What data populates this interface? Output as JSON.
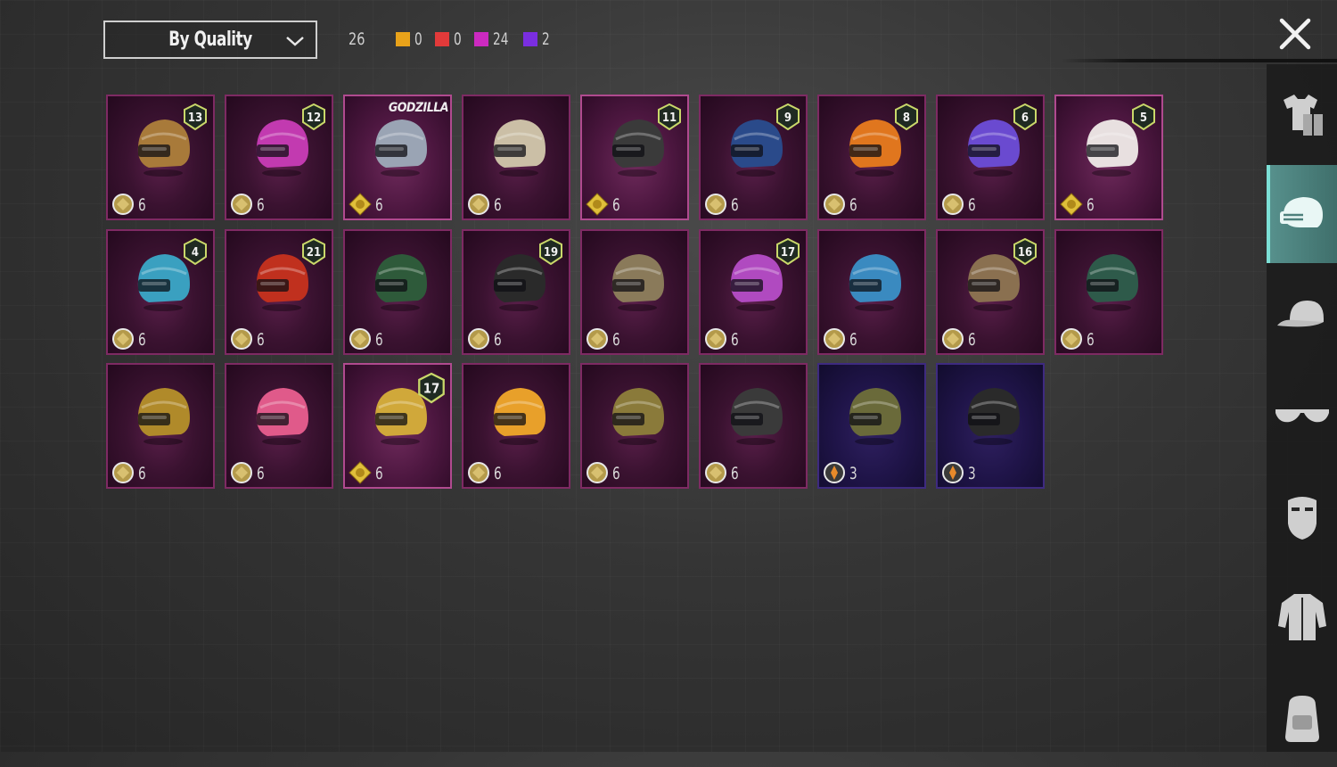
{
  "header": {
    "sort_label": "By Quality",
    "total": "26",
    "quality_counts": [
      {
        "color": "#e8a21a",
        "count": "0"
      },
      {
        "color": "#e23a3a",
        "count": "0"
      },
      {
        "color": "#cc2ac0",
        "count": "24"
      },
      {
        "color": "#7a2ee0",
        "count": "2"
      }
    ]
  },
  "sidebar": {
    "items": [
      {
        "icon": "outfit-icon",
        "active": false
      },
      {
        "icon": "helmet-icon",
        "active": true
      },
      {
        "icon": "cap-icon",
        "active": false
      },
      {
        "icon": "glasses-icon",
        "active": false
      },
      {
        "icon": "mask-icon",
        "active": false
      },
      {
        "icon": "jacket-icon",
        "active": false
      },
      {
        "icon": "backpack-icon",
        "active": false
      }
    ]
  },
  "items": [
    {
      "level": "13",
      "value": "6",
      "coin": "round",
      "color": "#a87a3a",
      "style": "normal"
    },
    {
      "level": "12",
      "value": "6",
      "coin": "round",
      "color": "#c23ab0",
      "style": "normal"
    },
    {
      "level": "",
      "value": "6",
      "coin": "diamond",
      "color": "#9aa4b4",
      "style": "highlight",
      "brand": "GODZILLA"
    },
    {
      "level": "",
      "value": "6",
      "coin": "round",
      "color": "#cbbfa6",
      "style": "normal"
    },
    {
      "level": "11",
      "value": "6",
      "coin": "diamond",
      "color": "#3a3a3a",
      "style": "highlight"
    },
    {
      "level": "9",
      "value": "6",
      "coin": "round",
      "color": "#2a4a8a",
      "style": "normal"
    },
    {
      "level": "8",
      "value": "6",
      "coin": "round",
      "color": "#e0761e",
      "style": "normal"
    },
    {
      "level": "6",
      "value": "6",
      "coin": "round",
      "color": "#6a4ad0",
      "style": "normal"
    },
    {
      "level": "5",
      "value": "6",
      "coin": "diamond",
      "color": "#e8e0e0",
      "style": "highlight"
    },
    {
      "level": "4",
      "value": "6",
      "coin": "round",
      "color": "#3aa0c0",
      "style": "normal"
    },
    {
      "level": "21",
      "value": "6",
      "coin": "round",
      "color": "#c0301e",
      "style": "normal"
    },
    {
      "level": "",
      "value": "6",
      "coin": "round",
      "color": "#2e5a3a",
      "style": "normal"
    },
    {
      "level": "19",
      "value": "6",
      "coin": "round",
      "color": "#2a2a2a",
      "style": "normal"
    },
    {
      "level": "",
      "value": "6",
      "coin": "round",
      "color": "#8a7a5a",
      "style": "normal"
    },
    {
      "level": "17",
      "value": "6",
      "coin": "round",
      "color": "#b04ac0",
      "style": "normal"
    },
    {
      "level": "",
      "value": "6",
      "coin": "round",
      "color": "#3a8ac0",
      "style": "normal"
    },
    {
      "level": "16",
      "value": "6",
      "coin": "round",
      "color": "#8a7050",
      "style": "normal"
    },
    {
      "level": "",
      "value": "6",
      "coin": "round",
      "color": "#2e5a4a",
      "style": "normal"
    },
    {
      "level": "",
      "value": "6",
      "coin": "round",
      "color": "#b08a2a",
      "style": "normal"
    },
    {
      "level": "",
      "value": "6",
      "coin": "round",
      "color": "#e05a8a",
      "style": "normal"
    },
    {
      "level": "17",
      "value": "6",
      "coin": "diamond",
      "color": "#d0a83a",
      "style": "highlight"
    },
    {
      "level": "",
      "value": "6",
      "coin": "round",
      "color": "#e8a02a",
      "style": "normal"
    },
    {
      "level": "",
      "value": "6",
      "coin": "round",
      "color": "#8a7a3a",
      "style": "normal"
    },
    {
      "level": "",
      "value": "6",
      "coin": "round",
      "color": "#3a3a3a",
      "style": "normal"
    },
    {
      "level": "",
      "value": "3",
      "coin": "epic",
      "color": "#6a6a3a",
      "style": "epic"
    },
    {
      "level": "",
      "value": "3",
      "coin": "epic",
      "color": "#2a2a2a",
      "style": "epic"
    }
  ]
}
